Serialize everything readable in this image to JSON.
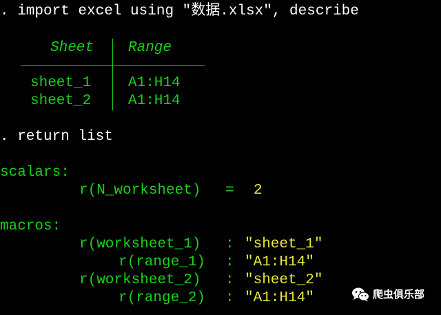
{
  "console": {
    "command_1": ". import excel using \"数据.xlsx\", describe",
    "table": {
      "header_sheet": "Sheet",
      "header_range": "Range",
      "rows": [
        {
          "sheet": "sheet_1",
          "range": "A1:H14"
        },
        {
          "sheet": "sheet_2",
          "range": "A1:H14"
        }
      ]
    },
    "command_2": ". return list",
    "scalars_heading": "scalars:",
    "scalar_name": "r(N_worksheet)",
    "scalar_eq": "=",
    "scalar_value": "2",
    "macros_heading": "macros:",
    "macros": [
      {
        "name": "r(worksheet_1)",
        "sep": ":",
        "value": "\"sheet_1\""
      },
      {
        "name": "r(range_1)",
        "sep": ":",
        "value": "\"A1:H14\""
      },
      {
        "name": "r(worksheet_2)",
        "sep": ":",
        "value": "\"sheet_2\""
      },
      {
        "name": "r(range_2)",
        "sep": ":",
        "value": "\"A1:H14\""
      }
    ]
  },
  "watermark": {
    "text": "爬虫俱乐部",
    "icon": "wechat-icon"
  },
  "colors": {
    "background": "#000000",
    "command_text": "#ffffff",
    "result_text": "#1ad11a",
    "value_text": "#e8e83a"
  }
}
